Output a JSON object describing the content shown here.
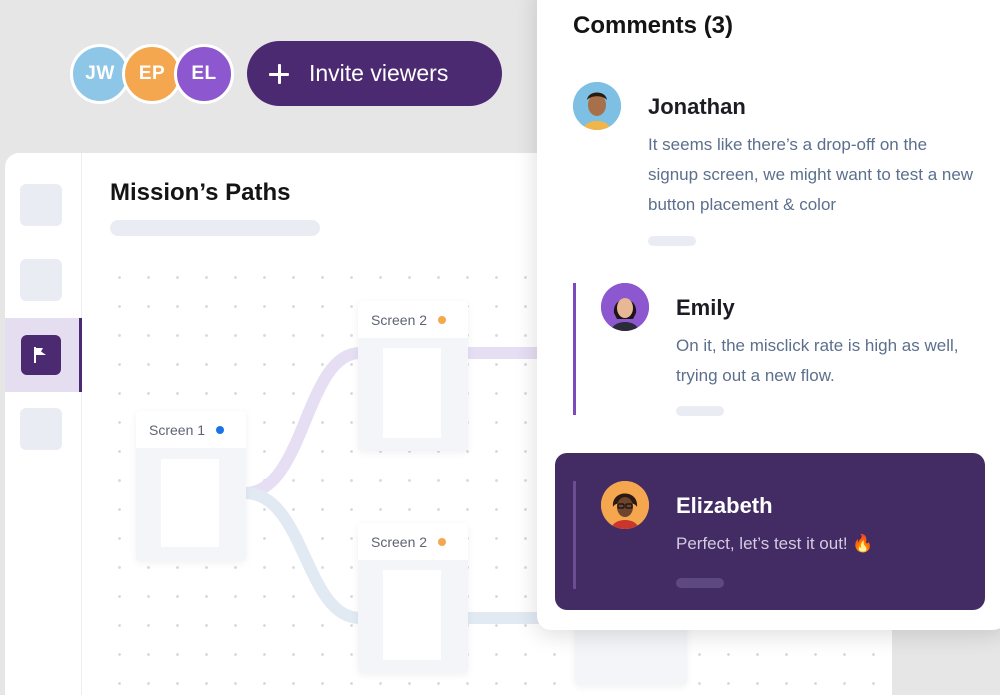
{
  "viewers": [
    {
      "initials": "JW",
      "color": "#8dc6e6"
    },
    {
      "initials": "EP",
      "color": "#f5a74f"
    },
    {
      "initials": "EL",
      "color": "#8d57cf"
    }
  ],
  "invite_button": {
    "label": "Invite viewers",
    "icon": "plus-icon"
  },
  "canvas": {
    "title": "Mission’s Paths",
    "nodes": [
      {
        "label": "Screen 1",
        "dot_color": "#1a73e8"
      },
      {
        "label": "Screen 2",
        "dot_color": "#f5a74f"
      },
      {
        "label": "Screen 2",
        "dot_color": "#f5a74f"
      }
    ],
    "tools": [
      {
        "icon": "tool-placeholder-icon"
      },
      {
        "icon": "tool-placeholder-icon"
      },
      {
        "icon": "flag-icon",
        "active": true
      },
      {
        "icon": "tool-placeholder-icon"
      }
    ]
  },
  "comments": {
    "title": "Comments (3)",
    "items": [
      {
        "author": "Jonathan",
        "text": "It seems like there’s a drop-off on the signup screen, we might want to test a new button placement & color"
      },
      {
        "author": "Emily",
        "text": "On it, the misclick rate is high as well, trying out a new flow."
      },
      {
        "author": "Elizabeth",
        "text": "Perfect, let’s test it out! 🔥"
      }
    ]
  },
  "colors": {
    "brand": "#4b2a72",
    "highlight_card": "#432b63",
    "path_purple": "#e6def3",
    "path_blue": "#e1e9f3"
  }
}
